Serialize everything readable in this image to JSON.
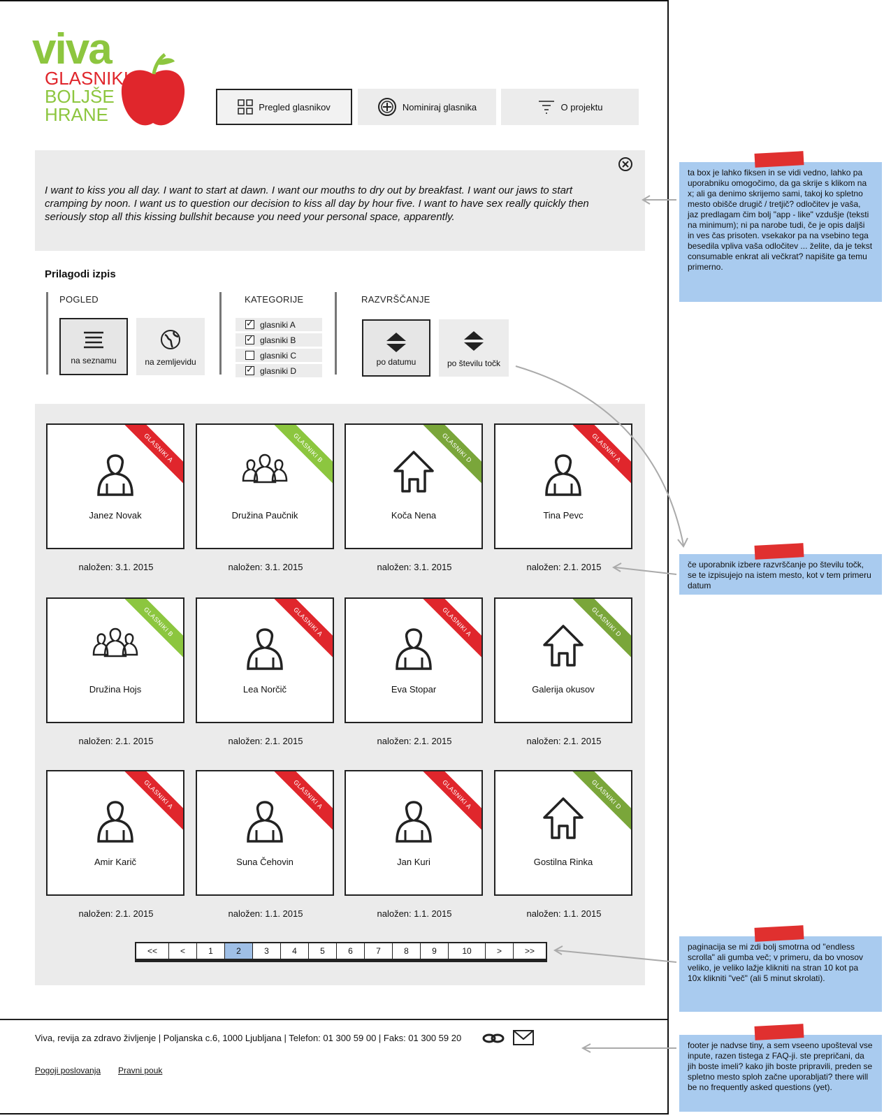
{
  "logo": {
    "brand": "viva",
    "line1": "GLASNIKI",
    "line2": "BOLJŠE",
    "line3": "HRANE"
  },
  "nav": [
    {
      "label": "Pregled glasnikov",
      "icon": "grid-icon",
      "active": true
    },
    {
      "label": "Nominiraj glasnika",
      "icon": "plus-circle-icon",
      "active": false
    },
    {
      "label": "O projektu",
      "icon": "filter-icon",
      "active": false
    }
  ],
  "intro": {
    "text": "I want to kiss you all day. I want to start at dawn. I want our mouths to dry out by breakfast. I want our jaws to start cramping by noon. I want us to question our decision to kiss all day by hour five. I want to have sex really quickly then seriously stop all this kissing bullshit because you need your personal space, apparently."
  },
  "customize": {
    "title": "Prilagodi izpis",
    "view": {
      "label": "POGLED",
      "options": [
        "na seznamu",
        "na zemljevidu"
      ],
      "selected": "na seznamu"
    },
    "categories": {
      "label": "KATEGORIJE",
      "items": [
        {
          "label": "glasniki A",
          "checked": true
        },
        {
          "label": "glasniki B",
          "checked": true
        },
        {
          "label": "glasniki C",
          "checked": false
        },
        {
          "label": "glasniki D",
          "checked": true
        }
      ]
    },
    "sort": {
      "label": "RAZVRŠČANJE",
      "options": [
        "po datumu",
        "po številu točk"
      ],
      "selected": "po datumu"
    }
  },
  "cards": [
    {
      "name": "Janez Novak",
      "date": "naložen: 3.1. 2015",
      "tag": "GLASNIKI A",
      "icon": "person-icon",
      "color": "#e0262c"
    },
    {
      "name": "Družina Paučnik",
      "date": "naložen: 3.1. 2015",
      "tag": "GLASNIKI B",
      "icon": "family-icon",
      "color": "#8cc63f"
    },
    {
      "name": "Koča Nena",
      "date": "naložen: 3.1. 2015",
      "tag": "GLASNIKI D",
      "icon": "house-icon",
      "color": "#7aa63a"
    },
    {
      "name": "Tina Pevc",
      "date": "naložen: 2.1. 2015",
      "tag": "GLASNIKI A",
      "icon": "person-icon",
      "color": "#e0262c"
    },
    {
      "name": "Družina Hojs",
      "date": "naložen: 2.1. 2015",
      "tag": "GLASNIKI B",
      "icon": "family-icon",
      "color": "#8cc63f"
    },
    {
      "name": "Lea Norčič",
      "date": "naložen: 2.1. 2015",
      "tag": "GLASNIKI A",
      "icon": "person-icon",
      "color": "#e0262c"
    },
    {
      "name": "Eva Stopar",
      "date": "naložen: 2.1. 2015",
      "tag": "GLASNIKI A",
      "icon": "person-icon",
      "color": "#e0262c"
    },
    {
      "name": "Galerija okusov",
      "date": "naložen: 2.1. 2015",
      "tag": "GLASNIKI D",
      "icon": "house-icon",
      "color": "#7aa63a"
    },
    {
      "name": "Amir Karič",
      "date": "naložen: 2.1. 2015",
      "tag": "GLASNIKI A",
      "icon": "person-icon",
      "color": "#e0262c"
    },
    {
      "name": "Suna Čehovin",
      "date": "naložen: 1.1. 2015",
      "tag": "GLASNIKI A",
      "icon": "person-icon",
      "color": "#e0262c"
    },
    {
      "name": "Jan Kuri",
      "date": "naložen: 1.1. 2015",
      "tag": "GLASNIKI A",
      "icon": "person-icon",
      "color": "#e0262c"
    },
    {
      "name": "Gostilna Rinka",
      "date": "naložen: 1.1. 2015",
      "tag": "GLASNIKI D",
      "icon": "house-icon",
      "color": "#7aa63a"
    }
  ],
  "pagination": {
    "items": [
      "<<",
      "<",
      "1",
      "2",
      "3",
      "4",
      "5",
      "6",
      "7",
      "8",
      "9",
      "10",
      ">",
      ">>"
    ],
    "current": "2"
  },
  "footer": {
    "address": "Viva, revija za zdravo življenje | Poljanska c.6, 1000 Ljubljana | Telefon: 01 300 59 00 | Faks: 01 300 59 20",
    "links": [
      "Pogoji poslovanja",
      "Pravni pouk"
    ]
  },
  "notes": [
    "ta box je lahko fiksen in se vidi vedno, lahko pa uporabniku omogočimo, da ga skrije s klikom na x; ali ga denimo skrijemo sami, takoj ko spletno mesto obišče drugič / tretjič? odločitev je vaša, jaz predlagam čim bolj \"app - like\" vzdušje (teksti na minimum); ni pa narobe tudi, če je opis daljši in ves čas prisoten. vsekakor pa na vsebino tega besedila vpliva vaša odločitev ... želite, da je tekst consumable enkrat ali večkrat? napišite ga temu primerno.",
    "če uporabnik izbere razvrščanje po številu točk, se te izpisujejo na istem mesto, kot v tem primeru datum",
    "paginacija se mi zdi bolj smotrna od \"endless scrolla\" ali gumba več; v primeru, da bo vnosov veliko, je veliko lažje klikniti na stran 10 kot pa 10x klikniti \"več\" (ali 5 minut skrolati).",
    "footer je nadvse tiny, a sem vseeno upošteval vse inpute, razen tistega z FAQ-ji. ste prepričani, da jih boste imeli? kako jih boste pripravili, preden se spletno mesto sploh začne uporabljati? there will be no frequently asked questions (yet)."
  ]
}
